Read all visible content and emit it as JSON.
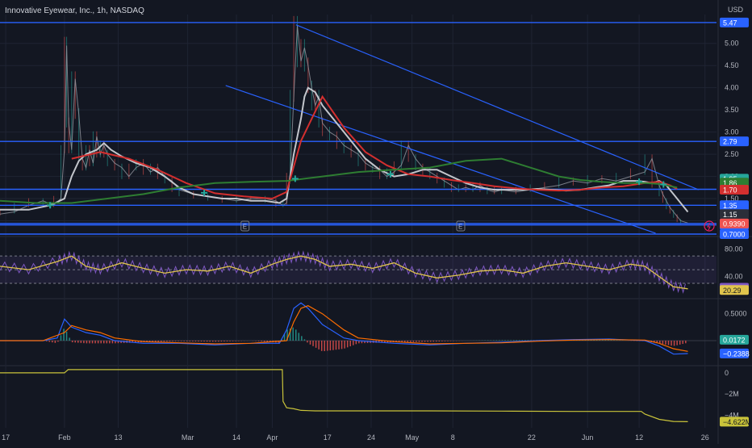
{
  "title": "Innovative Eyewear, Inc., 1h, NASDAQ",
  "currency": "USD",
  "colors": {
    "background": "#131722",
    "grid": "#1f2433",
    "blue_line": "#2962ff",
    "price": "#9598a1",
    "ma_gray": "#c3c6cc",
    "ma_red": "#d32f2f",
    "ma_green": "#2e7d32",
    "marker": "#26a69a",
    "rsi": "#e0c44c",
    "rsi_band": "#7e57c2",
    "macd": "#2962ff",
    "signal": "#ff6d00",
    "volume_line": "#c9c33a"
  },
  "chart_data": [
    {
      "type": "line",
      "pane": "price",
      "ylim": [
        0.7,
        5.65
      ],
      "yticks": [
        1.0,
        1.5,
        2.0,
        2.5,
        3.0,
        3.5,
        4.0,
        4.5,
        5.0
      ],
      "ytick_labels": [
        "1.00",
        "1.50",
        "2.00",
        "2.50",
        "3.00",
        "3.50",
        "4.00",
        "4.50",
        "5.00"
      ],
      "x_labels": [
        "17",
        "Feb",
        "13",
        "Mar",
        "14",
        "Apr",
        "17",
        "24",
        "May",
        "8",
        "22",
        "Jun",
        "12",
        "26"
      ],
      "horizontal_levels": [
        {
          "value": 5.47,
          "label": "5.47"
        },
        {
          "value": 2.79,
          "label": "2.79"
        },
        {
          "value": 1.71,
          "label": "1.71"
        },
        {
          "value": 1.35,
          "label": "1.35"
        },
        {
          "value": 0.939,
          "label": "0.9390"
        },
        {
          "value": 0.905,
          "label": "0.9050"
        },
        {
          "value": 0.7,
          "label": "0.7000"
        }
      ],
      "trend_lines": [
        {
          "x": [
            0.413,
            0.975
          ],
          "y": [
            5.42,
            1.7
          ]
        },
        {
          "x": [
            0.315,
            0.915
          ],
          "y": [
            4.05,
            0.72
          ]
        }
      ],
      "price_labels": [
        {
          "value": 1.95,
          "label": "1.95",
          "color": "#26a69a"
        },
        {
          "value": 1.86,
          "label": "1.86",
          "color": "#2e7d32"
        },
        {
          "value": 1.7,
          "label": "1.70",
          "color": "#d32f2f"
        },
        {
          "value": 1.15,
          "label": "1.15",
          "color": "#2a2e39"
        }
      ],
      "series": [
        {
          "role": "price",
          "x": [
            0.0,
            0.02,
            0.04,
            0.06,
            0.075,
            0.085,
            0.09,
            0.093,
            0.096,
            0.1,
            0.105,
            0.11,
            0.115,
            0.12,
            0.125,
            0.13,
            0.135,
            0.14,
            0.145,
            0.15,
            0.16,
            0.17,
            0.18,
            0.19,
            0.2,
            0.21,
            0.22,
            0.23,
            0.24,
            0.25,
            0.27,
            0.29,
            0.31,
            0.33,
            0.35,
            0.37,
            0.385,
            0.395,
            0.4,
            0.405,
            0.41,
            0.415,
            0.42,
            0.425,
            0.43,
            0.435,
            0.44,
            0.445,
            0.45,
            0.46,
            0.47,
            0.48,
            0.49,
            0.5,
            0.51,
            0.52,
            0.53,
            0.54,
            0.55,
            0.56,
            0.57,
            0.58,
            0.59,
            0.6,
            0.61,
            0.62,
            0.63,
            0.64,
            0.65,
            0.66,
            0.67,
            0.68,
            0.69,
            0.7,
            0.72,
            0.74,
            0.76,
            0.78,
            0.8,
            0.82,
            0.84,
            0.86,
            0.88,
            0.9,
            0.91,
            0.92,
            0.925,
            0.93,
            0.935,
            0.94,
            0.945,
            0.95,
            0.96
          ],
          "y": [
            1.15,
            1.2,
            1.35,
            1.45,
            1.35,
            1.5,
            2.6,
            4.95,
            3.2,
            2.6,
            4.2,
            3.4,
            2.4,
            2.2,
            2.6,
            2.3,
            2.9,
            2.5,
            2.7,
            2.5,
            2.3,
            2.2,
            2.0,
            2.2,
            2.3,
            2.1,
            2.2,
            2.0,
            1.9,
            1.7,
            1.6,
            1.55,
            1.5,
            1.45,
            1.5,
            1.5,
            1.45,
            1.35,
            1.4,
            2.0,
            3.8,
            5.4,
            4.6,
            4.9,
            4.5,
            4.0,
            3.6,
            3.8,
            3.2,
            3.0,
            2.9,
            2.7,
            2.6,
            2.5,
            2.3,
            2.2,
            2.15,
            2.0,
            2.1,
            2.25,
            2.7,
            2.4,
            2.2,
            2.1,
            2.0,
            1.9,
            1.8,
            1.7,
            1.75,
            1.7,
            1.8,
            1.7,
            1.65,
            1.7,
            1.65,
            1.7,
            1.75,
            1.8,
            1.9,
            1.85,
            1.95,
            1.9,
            2.0,
            2.1,
            2.4,
            1.8,
            1.6,
            1.45,
            1.3,
            1.2,
            1.1,
            1.0,
            0.95
          ]
        },
        {
          "role": "ma_fast",
          "x": [
            0.0,
            0.04,
            0.07,
            0.09,
            0.1,
            0.11,
            0.12,
            0.135,
            0.145,
            0.155,
            0.17,
            0.19,
            0.21,
            0.23,
            0.25,
            0.27,
            0.29,
            0.31,
            0.33,
            0.35,
            0.37,
            0.39,
            0.4,
            0.41,
            0.42,
            0.425,
            0.43,
            0.44,
            0.45,
            0.47,
            0.49,
            0.51,
            0.53,
            0.55,
            0.57,
            0.59,
            0.61,
            0.63,
            0.65,
            0.67,
            0.69,
            0.71,
            0.73,
            0.75,
            0.77,
            0.79,
            0.81,
            0.83,
            0.85,
            0.86,
            0.87,
            0.88,
            0.89,
            0.9,
            0.91,
            0.92,
            0.93,
            0.94,
            0.95,
            0.96
          ],
          "y": [
            1.25,
            1.25,
            1.35,
            1.5,
            2.0,
            2.35,
            2.5,
            2.6,
            2.75,
            2.6,
            2.45,
            2.3,
            2.2,
            2.0,
            1.75,
            1.6,
            1.55,
            1.5,
            1.5,
            1.45,
            1.45,
            1.4,
            1.5,
            2.5,
            3.3,
            3.8,
            4.0,
            3.9,
            3.6,
            3.2,
            2.8,
            2.4,
            2.15,
            2.0,
            2.05,
            2.15,
            2.15,
            2.0,
            1.85,
            1.75,
            1.7,
            1.7,
            1.7,
            1.72,
            1.7,
            1.68,
            1.7,
            1.75,
            1.8,
            1.85,
            1.9,
            1.9,
            1.9,
            1.88,
            1.85,
            1.9,
            1.8,
            1.6,
            1.4,
            1.2
          ]
        },
        {
          "role": "ma_mid",
          "x": [
            0.1,
            0.14,
            0.18,
            0.22,
            0.26,
            0.3,
            0.34,
            0.38,
            0.4,
            0.42,
            0.45,
            0.48,
            0.51,
            0.54,
            0.57,
            0.6,
            0.63,
            0.66,
            0.69,
            0.72,
            0.75,
            0.78,
            0.81,
            0.84,
            0.87,
            0.9,
            0.92,
            0.935,
            0.945
          ],
          "y": [
            2.4,
            2.55,
            2.4,
            2.15,
            1.85,
            1.62,
            1.55,
            1.5,
            1.65,
            2.8,
            3.8,
            3.1,
            2.55,
            2.25,
            2.05,
            2.0,
            1.92,
            1.85,
            1.78,
            1.73,
            1.7,
            1.68,
            1.7,
            1.75,
            1.78,
            1.85,
            1.88,
            1.8,
            1.72
          ]
        },
        {
          "role": "ma_slow",
          "x": [
            0.0,
            0.05,
            0.1,
            0.15,
            0.2,
            0.25,
            0.3,
            0.35,
            0.4,
            0.45,
            0.5,
            0.55,
            0.6,
            0.65,
            0.7,
            0.72,
            0.75,
            0.78,
            0.81,
            0.84,
            0.87,
            0.9,
            0.92,
            0.945
          ],
          "y": [
            1.45,
            1.4,
            1.4,
            1.5,
            1.6,
            1.75,
            1.85,
            1.88,
            1.9,
            2.0,
            2.1,
            2.15,
            2.2,
            2.35,
            2.4,
            2.3,
            2.15,
            2.0,
            1.92,
            1.88,
            1.85,
            1.85,
            1.83,
            1.75
          ]
        }
      ],
      "cross_markers": [
        {
          "x": 0.07,
          "y": 1.35
        },
        {
          "x": 0.285,
          "y": 1.63
        },
        {
          "x": 0.412,
          "y": 1.95
        },
        {
          "x": 0.545,
          "y": 2.05
        },
        {
          "x": 0.892,
          "y": 1.88
        },
        {
          "x": 0.926,
          "y": 1.82
        }
      ],
      "event_labels": [
        {
          "x": 0.342,
          "label": "E"
        },
        {
          "x": 0.643,
          "label": "E"
        }
      ]
    },
    {
      "type": "line",
      "pane": "rsi",
      "ylim": [
        10,
        95
      ],
      "yticks": [
        80,
        40
      ],
      "ytick_labels": [
        "80.00",
        "40.00"
      ],
      "band": [
        70,
        30
      ],
      "midline": 50,
      "last_labels": [
        {
          "value": 23.56,
          "label": "23.56",
          "color": "#7e57c2"
        },
        {
          "value": 20.29,
          "label": "20.29",
          "color": "#e0c44c"
        }
      ],
      "series": [
        {
          "role": "rsi_smooth",
          "x": [
            0.0,
            0.04,
            0.08,
            0.1,
            0.12,
            0.14,
            0.17,
            0.2,
            0.23,
            0.26,
            0.29,
            0.32,
            0.35,
            0.38,
            0.4,
            0.42,
            0.44,
            0.46,
            0.49,
            0.52,
            0.55,
            0.58,
            0.61,
            0.64,
            0.67,
            0.7,
            0.73,
            0.76,
            0.79,
            0.82,
            0.85,
            0.88,
            0.9,
            0.92,
            0.94,
            0.96
          ],
          "y": [
            55,
            50,
            62,
            70,
            55,
            50,
            60,
            52,
            45,
            50,
            48,
            55,
            45,
            58,
            65,
            70,
            65,
            55,
            58,
            52,
            60,
            45,
            38,
            42,
            48,
            50,
            45,
            55,
            60,
            55,
            50,
            58,
            55,
            40,
            25,
            22
          ]
        }
      ]
    },
    {
      "type": "line",
      "pane": "macd",
      "ylim": [
        -0.45,
        0.75
      ],
      "yticks": [
        0.5
      ],
      "ytick_labels": [
        "0.5000"
      ],
      "last_labels": [
        {
          "value": 0.0172,
          "label": "0.0172",
          "color": "#26a69a"
        },
        {
          "value": -0.2388,
          "label": "−0.2388",
          "color": "#2962ff"
        }
      ],
      "series": [
        {
          "role": "macd",
          "x": [
            0.0,
            0.06,
            0.08,
            0.09,
            0.1,
            0.12,
            0.14,
            0.16,
            0.2,
            0.25,
            0.3,
            0.35,
            0.39,
            0.4,
            0.41,
            0.42,
            0.43,
            0.45,
            0.48,
            0.5,
            0.55,
            0.6,
            0.65,
            0.7,
            0.75,
            0.8,
            0.85,
            0.9,
            0.92,
            0.94,
            0.96
          ],
          "y": [
            0.0,
            0.0,
            0.05,
            0.4,
            0.25,
            0.15,
            0.1,
            0.0,
            -0.05,
            -0.05,
            -0.08,
            -0.05,
            -0.05,
            0.2,
            0.6,
            0.7,
            0.6,
            0.3,
            0.05,
            0.0,
            -0.05,
            -0.08,
            -0.05,
            -0.03,
            0.0,
            0.02,
            0.03,
            0.0,
            -0.1,
            -0.25,
            -0.24
          ]
        },
        {
          "role": "signal",
          "x": [
            0.0,
            0.06,
            0.09,
            0.1,
            0.12,
            0.14,
            0.16,
            0.2,
            0.25,
            0.3,
            0.35,
            0.4,
            0.41,
            0.42,
            0.43,
            0.45,
            0.48,
            0.5,
            0.55,
            0.6,
            0.65,
            0.7,
            0.75,
            0.8,
            0.85,
            0.9,
            0.92,
            0.94,
            0.96
          ],
          "y": [
            0.0,
            0.0,
            0.15,
            0.28,
            0.2,
            0.15,
            0.05,
            -0.02,
            -0.04,
            -0.06,
            -0.05,
            0.0,
            0.35,
            0.6,
            0.65,
            0.5,
            0.2,
            0.05,
            -0.02,
            -0.06,
            -0.05,
            -0.04,
            -0.01,
            0.01,
            0.02,
            0.01,
            -0.05,
            -0.15,
            -0.2
          ]
        }
      ]
    },
    {
      "type": "line",
      "pane": "volume_cumulative",
      "ylim": [
        -5.2,
        0.6
      ],
      "yticks": [
        0,
        -2,
        -4
      ],
      "ytick_labels": [
        "0",
        "−2M",
        "−4M"
      ],
      "last_labels": [
        {
          "value": -4.622,
          "label": "−4.622M",
          "color": "#c9c33a"
        }
      ],
      "series": [
        {
          "role": "accumulation",
          "x": [
            0.0,
            0.09,
            0.095,
            0.394,
            0.395,
            0.4,
            0.41,
            0.42,
            0.44,
            0.5,
            0.6,
            0.7,
            0.8,
            0.895,
            0.9,
            0.92,
            0.94,
            0.96
          ],
          "y": [
            0.0,
            0.0,
            0.3,
            0.3,
            -2.7,
            -3.3,
            -3.4,
            -3.55,
            -3.6,
            -3.6,
            -3.6,
            -3.62,
            -3.65,
            -3.65,
            -3.9,
            -4.4,
            -4.6,
            -4.62
          ]
        }
      ]
    }
  ]
}
